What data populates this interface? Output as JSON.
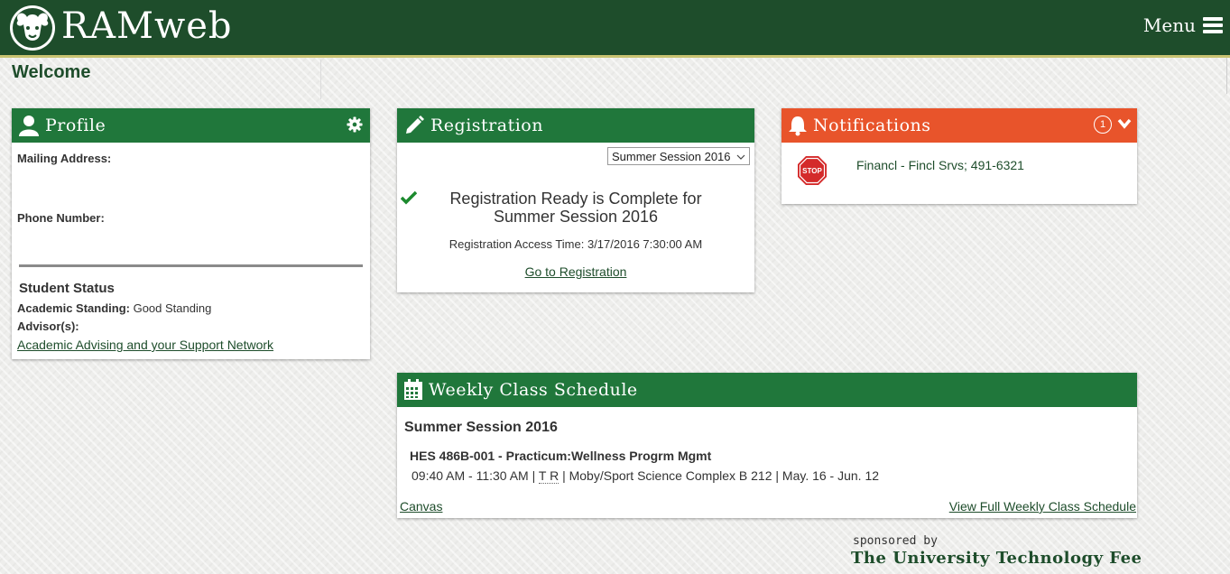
{
  "header": {
    "brand": "RAMweb",
    "menu_label": "Menu",
    "colors": {
      "bar": "#1e4d2b",
      "accent": "#c8c372"
    }
  },
  "page": {
    "title": "Welcome"
  },
  "profile": {
    "title": "Profile",
    "mailing_label": "Mailing Address:",
    "phone_label": "Phone Number:",
    "status_heading": "Student Status",
    "standing_label": "Academic Standing:",
    "standing_value": "Good Standing",
    "advisors_label": "Advisor(s):",
    "advising_link": "Academic Advising and your Support Network"
  },
  "registration": {
    "title": "Registration",
    "term_selected": "Summer Session 2016",
    "complete_text": "Registration Ready is Complete for Summer Session 2016",
    "access_time": "Registration Access Time: 3/17/2016 7:30:00 AM",
    "go_link": "Go to Registration"
  },
  "notifications": {
    "title": "Notifications",
    "count": "1",
    "items": [
      {
        "icon": "stop-sign-icon",
        "text": "Financl - Fincl Srvs; 491-6321"
      }
    ],
    "color": "#e8542b"
  },
  "schedule": {
    "title": "Weekly Class Schedule",
    "term": "Summer Session 2016",
    "course_title": "HES 486B-001 - Practicum:Wellness Progrm Mgmt",
    "course_time": "09:40 AM - 11:30 AM |",
    "course_days": "T R",
    "course_rest": "| Moby/Sport Science Complex B 212 | May. 16 - Jun. 12",
    "canvas_link": "Canvas",
    "full_link": "View Full Weekly Class Schedule"
  },
  "footer": {
    "sponsored_by": "sponsored by",
    "sponsor_name": "The University Technology Fee"
  }
}
